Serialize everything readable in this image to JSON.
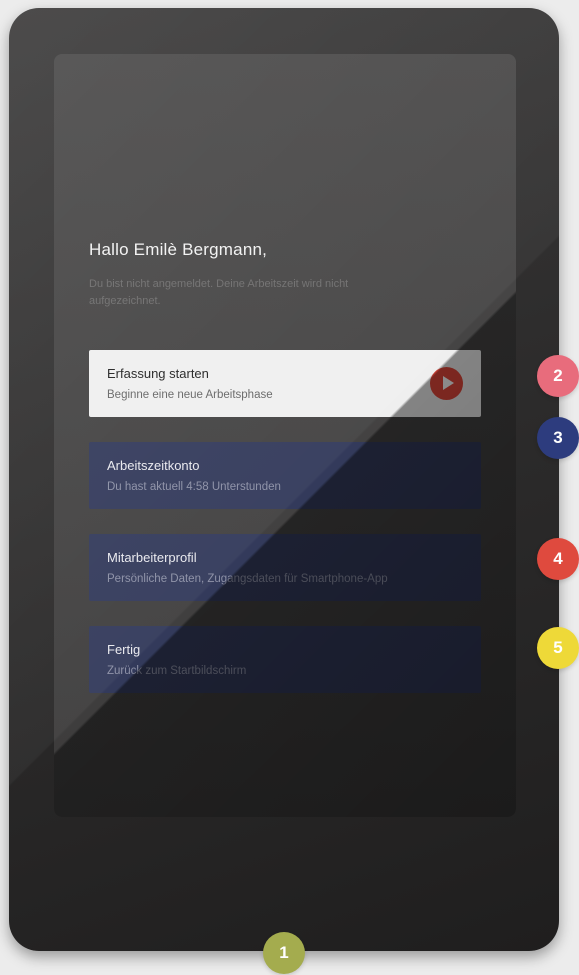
{
  "greeting": "Hallo Emilè Bergmann,",
  "status_text": "Du bist nicht angemeldet. Deine Arbeitszeit wird nicht aufgezeichnet.",
  "menu": [
    {
      "title": "Erfassung starten",
      "desc": "Beginne eine neue Arbeitsphase",
      "icon": "play-icon"
    },
    {
      "title": "Arbeitszeitkonto",
      "desc": "Du hast aktuell 4:58 Unterstunden"
    },
    {
      "title": "Mitarbeiterprofil",
      "desc": "Persönliche Daten, Zugangsdaten für Smartphone-App"
    },
    {
      "title": "Fertig",
      "desc": "Zurück zum Startbildschirm"
    }
  ],
  "callouts": [
    {
      "label": "1",
      "color": "#a4ac4e"
    },
    {
      "label": "2",
      "color": "#e86c7c"
    },
    {
      "label": "3",
      "color": "#2d3c7e"
    },
    {
      "label": "4",
      "color": "#df4a3e"
    },
    {
      "label": "5",
      "color": "#eed938"
    }
  ],
  "colors": {
    "accent": "#e2473a",
    "card_dark": "#333a5b",
    "card_light": "#efefef"
  }
}
